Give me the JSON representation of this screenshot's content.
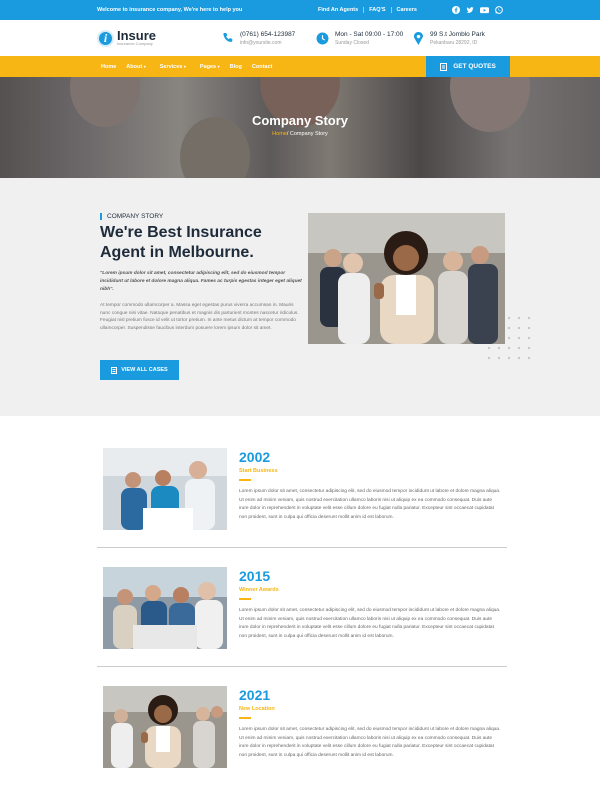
{
  "topbar": {
    "welcome": "Welcome to insurance company, We're here to help you",
    "links": [
      "Find An Agents",
      "FAQ'S",
      "Careers"
    ],
    "social_icons": [
      "facebook-icon",
      "twitter-icon",
      "youtube-icon",
      "whatsapp-icon"
    ]
  },
  "header": {
    "logo_letter": "i",
    "logo_name": "Insure",
    "logo_tagline": "Insurance Company",
    "phone": "(0761) 654-123987",
    "email": "info@yoursite.com",
    "hours": "Mon - Sat 09:00 - 17:00",
    "closed": "Sunday Closed",
    "address": "99 S.t Jomblo Park",
    "address2": "Pekanbaru 28292, ID"
  },
  "nav": {
    "items": [
      "Home",
      "About",
      "Services",
      "Pages",
      "Blog",
      "Contact"
    ],
    "quote_label": "GET QUOTES"
  },
  "hero": {
    "title": "Company Story",
    "breadcrumb_home": "Home",
    "breadcrumb_current": "/ Company Story"
  },
  "intro": {
    "kicker": "COMPANY STORY",
    "heading": "We're Best Insurance Agent in Melbourne.",
    "lead": "\"Lorem ipsum dolor sit amet, consectetur adipiscing elit, sed do eiusmod tempor incididunt ut labore et dolore magna aliqua. Fames ac turpis egestas integer eget aliquet nibh\".",
    "body": "At tempor commodo ullamcorper a. Massa eget egestas purus viverra accumsan in. Mauris nunc congue nisi vitae. Natoque penatibus et magnis dis parturient montes nascetur ridiculus. Feugiat nisl pretium fusce id velit ut tortor pretium. In ante metus dictum at tempor commodo ullamcorper. Suspendisse faucibus interdum posuere lorem ipsum dolor sit amet.",
    "button_label": "VIEW ALL CASES"
  },
  "timeline": [
    {
      "year": "2002",
      "subtitle": "Start Business",
      "text": "Lorem ipsum dolor sit amet, consectetur adipiscing elit, sed do eiusmod tempor incididunt ut labore et dolore magna aliqua. Ut enim ad minim veniam, quis nostrud exercitation ullamco laboris nisi ut aliquip ex ea commodo consequat. Duis aute irure dolor in reprehenderit in voluptate velit esse cillum dolore eu fugiat nulla pariatur. Excepteur sint occaecat cupidatat non proident, sunt in culpa qui officia deserunt mollit anim id est laborum."
    },
    {
      "year": "2015",
      "subtitle": "Winner Awards",
      "text": "Lorem ipsum dolor sit amet, consectetur adipiscing elit, sed do eiusmod tempor incididunt ut labore et dolore magna aliqua. Ut enim ad minim veniam, quis nostrud exercitation ullamco laboris nisi ut aliquip ex ea commodo consequat. Duis aute irure dolor in reprehenderit in voluptate velit esse cillum dolore eu fugiat nulla pariatur. Excepteur sint occaecat cupidatat non proident, sunt in culpa qui officia deserunt mollit anim id est laborum."
    },
    {
      "year": "2021",
      "subtitle": "New Location",
      "text": "Lorem ipsum dolor sit amet, consectetur adipiscing elit, sed do eiusmod tempor incididunt ut labore et dolore magna aliqua. Ut enim ad minim veniam, quis nostrud exercitation ullamco laboris nisi ut aliquip ex ea commodo consequat. Duis aute irure dolor in reprehenderit in voluptate velit esse cillum dolore eu fugiat nulla pariatur. Excepteur sint occaecat cupidatat non proident, sunt in culpa qui officia deserunt mollit anim id est laborum."
    }
  ],
  "colors": {
    "primary": "#1a9be0",
    "accent": "#f7b614",
    "dark": "#1d2b3a"
  }
}
